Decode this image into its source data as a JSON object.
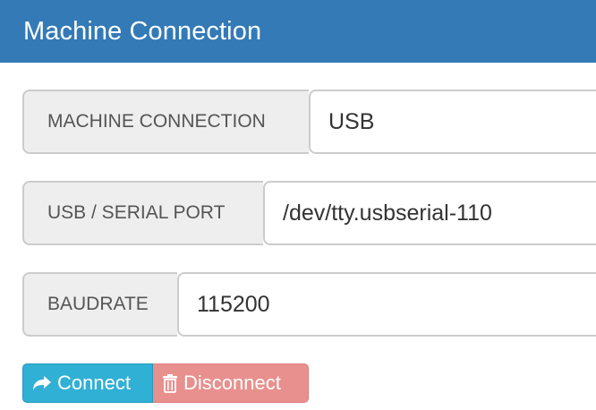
{
  "panel": {
    "title": "Machine Connection"
  },
  "connection": {
    "label": "MACHINE CONNECTION",
    "value": "USB"
  },
  "port": {
    "label": "USB / SERIAL PORT",
    "value": "/dev/tty.usbserial-110"
  },
  "baudrate": {
    "label": "BAUDRATE",
    "value": "115200"
  },
  "buttons": {
    "connect_label": "Connect",
    "connect_icon": "share-arrow-icon",
    "disconnect_label": "Disconnect",
    "disconnect_icon": "trash-icon"
  },
  "colors": {
    "header": "#337ab7",
    "connect": "#31b0d5",
    "disconnect": "#e8908e"
  }
}
